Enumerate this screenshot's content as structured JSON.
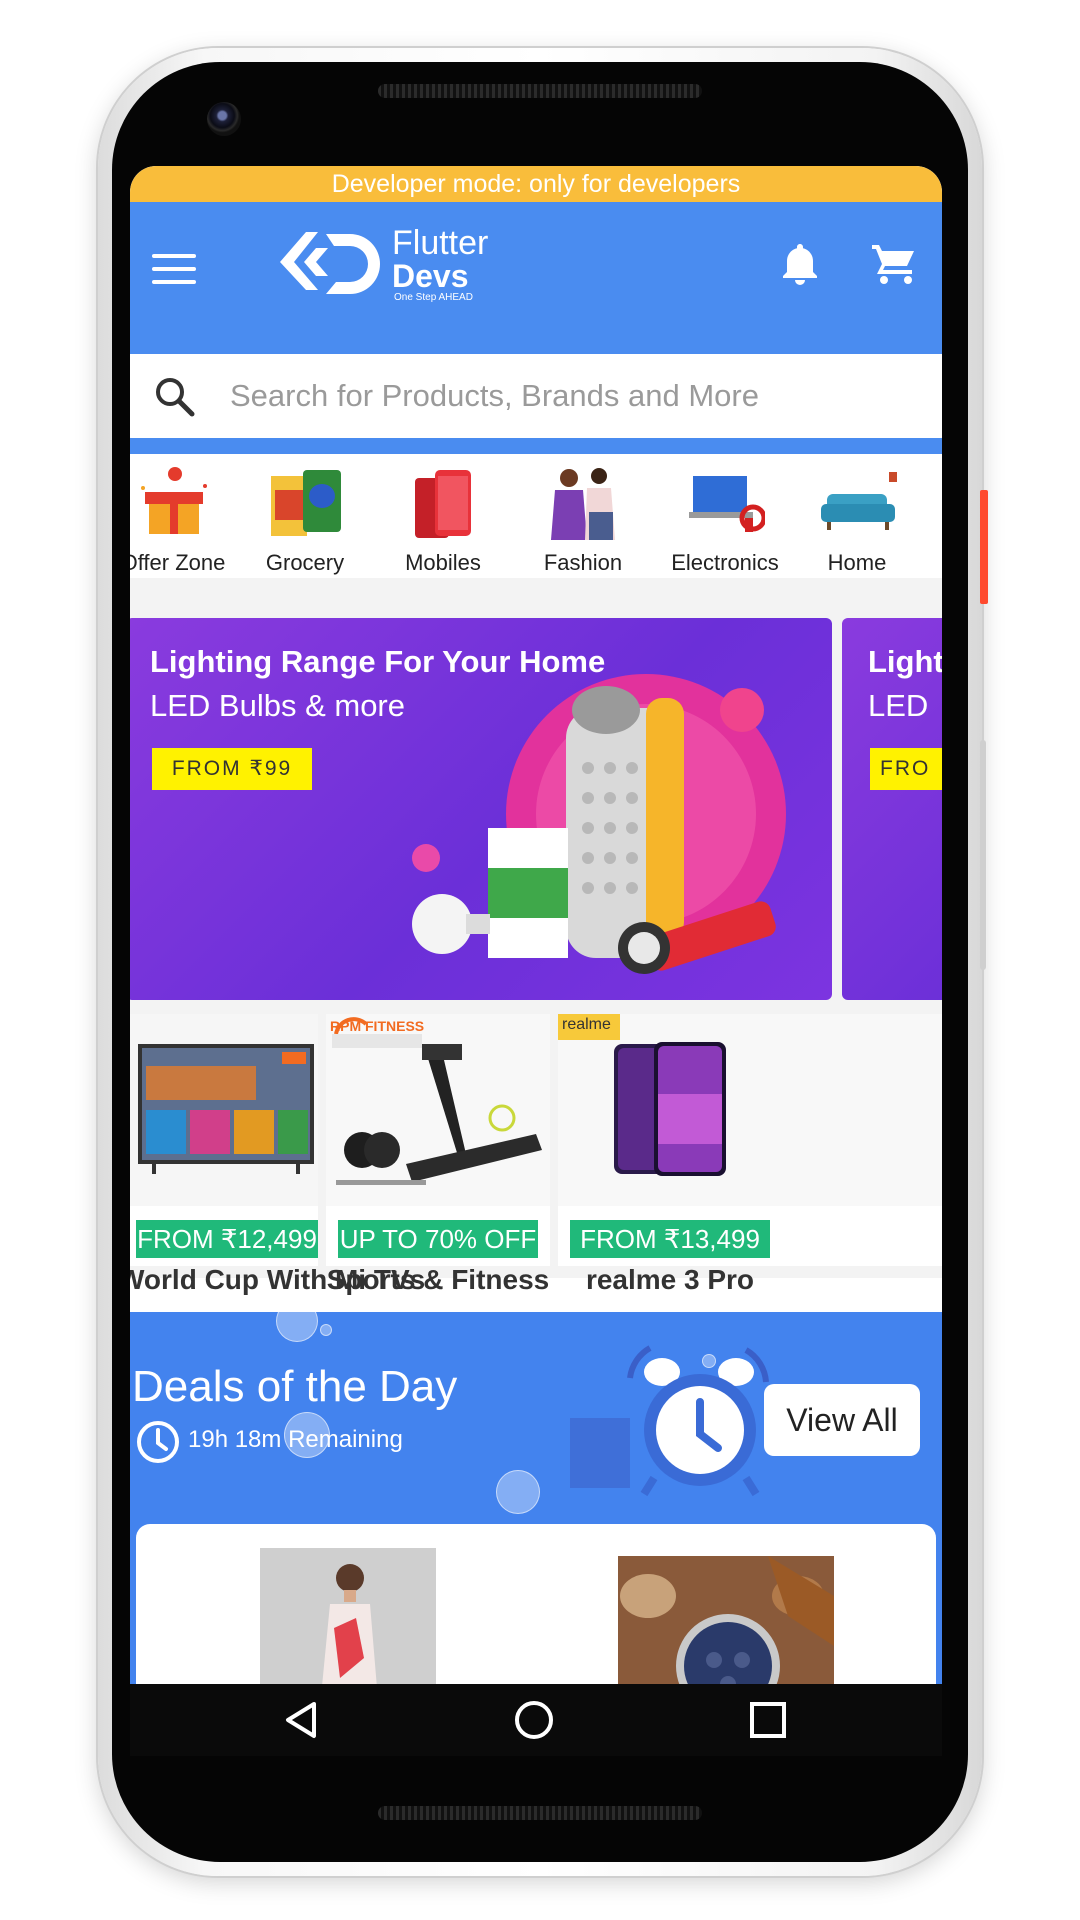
{
  "dev_banner": "Developer mode: only for developers",
  "header": {
    "logo_line1": "Flutter",
    "logo_line2": "Devs",
    "logo_tagline": "One Step AHEAD",
    "icons": [
      "menu-icon",
      "bell-icon",
      "cart-icon"
    ]
  },
  "search": {
    "placeholder": "Search for Products, Brands and More"
  },
  "categories": [
    {
      "label": "Offer Zone"
    },
    {
      "label": "Grocery"
    },
    {
      "label": "Mobiles"
    },
    {
      "label": "Fashion"
    },
    {
      "label": "Electronics"
    },
    {
      "label": "Home"
    }
  ],
  "banner": {
    "title": "Lighting Range For Your Home",
    "subtitle": "LED Bulbs & more",
    "button": "FROM ₹99",
    "peek_title": "Light",
    "peek_subtitle": "LED",
    "peek_button": "FRO"
  },
  "promos": [
    {
      "tag": "FROM ₹12,499",
      "title": "World Cup With Mi TVs",
      "brand": ""
    },
    {
      "tag": "UP TO 70% OFF",
      "title": "Sports & Fitness",
      "brand": "RPM FITNESS"
    },
    {
      "tag": "FROM ₹13,499",
      "title": "realme 3 Pro",
      "brand": "realme"
    }
  ],
  "deals": {
    "title": "Deals of the Day",
    "remaining": "19h 18m Remaining",
    "view_all": "View All"
  },
  "colors": {
    "dev_banner": "#f9bd3b",
    "app_bar": "#4a8cf0",
    "deals_bg": "#4383ee",
    "promo_tag": "#20b97a",
    "banner_button": "#fff200"
  }
}
